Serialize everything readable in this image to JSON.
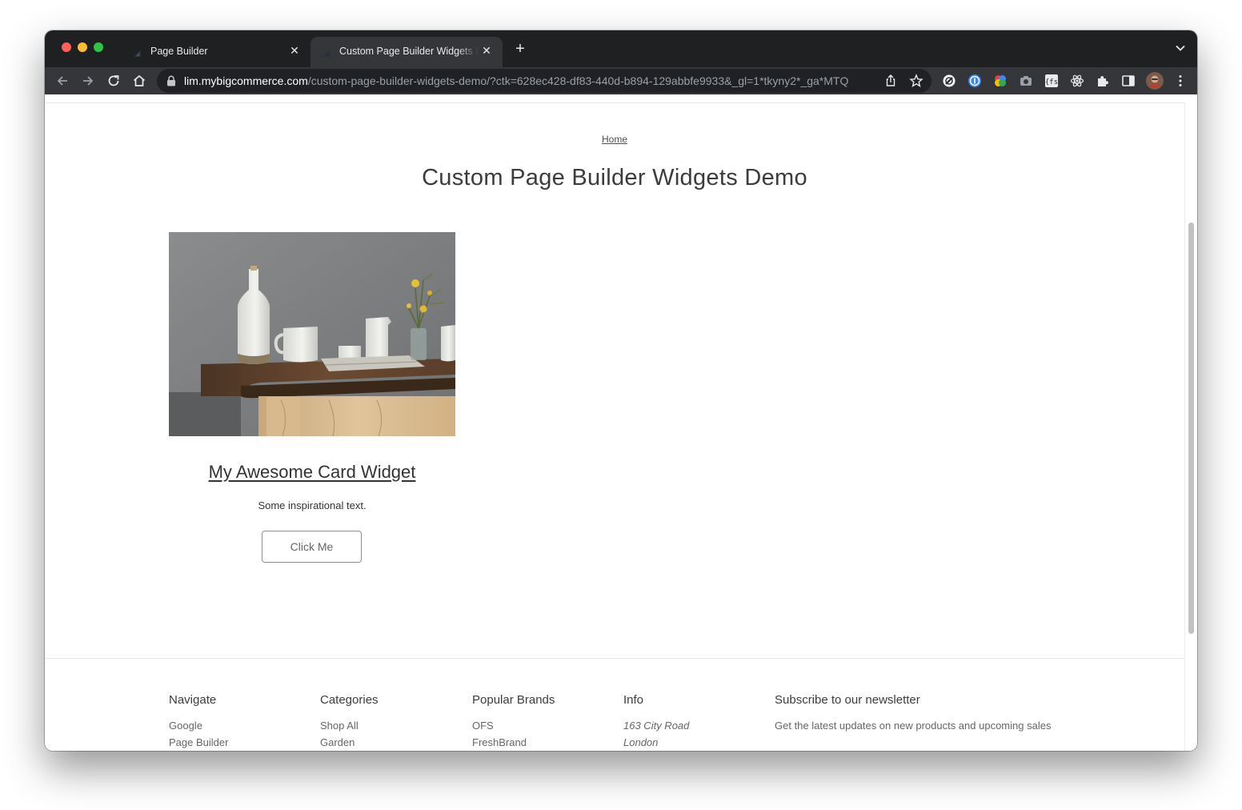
{
  "browser": {
    "tabs": [
      {
        "title": "Page Builder",
        "active": false,
        "close": "✕"
      },
      {
        "title": "Custom Page Builder Widgets Demo",
        "active": true,
        "close": "✕"
      }
    ],
    "new_tab": "+",
    "address": {
      "host": "lim.mybigcommerce.com",
      "path": "/custom-page-builder-widgets-demo/?ctk=628ec428-df83-440d-b894-129abbfe9933&_gl=1*tkyny2*_ga*MTQ"
    },
    "icons": {
      "back": "back-arrow-icon",
      "forward": "forward-arrow-icon",
      "reload": "reload-icon",
      "home": "home-icon",
      "lock": "lock-icon",
      "share": "share-icon",
      "bookmark": "star-icon",
      "menu": "kebab-menu-icon"
    }
  },
  "page": {
    "breadcrumb": "Home",
    "title": "Custom Page Builder Widgets Demo"
  },
  "card": {
    "image_alt": "White ceramic bottle, mugs and pitcher with yellow flowers on a walnut table",
    "title": "My Awesome Card Widget",
    "text": "Some inspirational text.",
    "button": "Click Me"
  },
  "footer": {
    "navigate": {
      "heading": "Navigate",
      "links": [
        "Google",
        "Page Builder"
      ]
    },
    "categories": {
      "heading": "Categories",
      "links": [
        "Shop All",
        "Garden"
      ]
    },
    "brands": {
      "heading": "Popular Brands",
      "links": [
        "OFS",
        "FreshBrand"
      ]
    },
    "info": {
      "heading": "Info",
      "lines": [
        "163 City Road",
        "London"
      ]
    },
    "newsletter": {
      "heading": "Subscribe to our newsletter",
      "text": "Get the latest updates on new products and upcoming sales"
    }
  },
  "colors": {
    "tabbar": "#1f2022",
    "toolbar": "#35363a",
    "omnibox": "#202124",
    "title_text": "#3c3c3c",
    "body_text": "#666666"
  }
}
